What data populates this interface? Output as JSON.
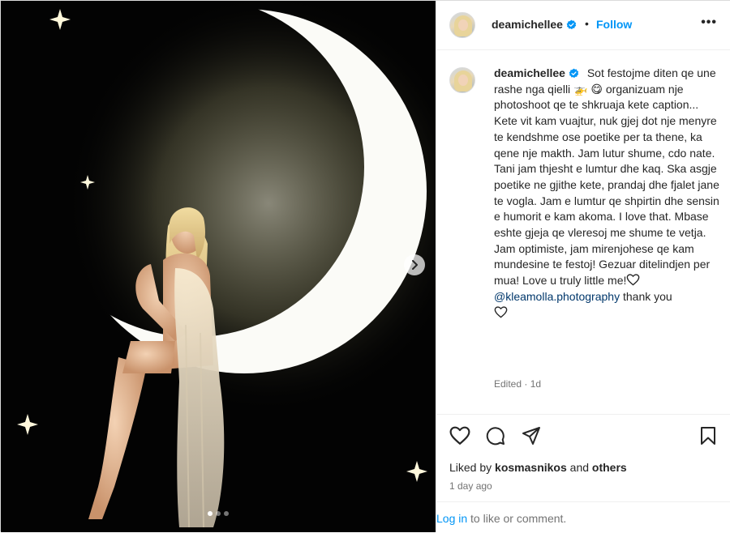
{
  "post": {
    "username": "deamichellee",
    "separator": "•",
    "follow_label": "Follow",
    "more_label": "•••",
    "caption": {
      "text_main": "Sot festojme diten qe une rashe nga qielli 🚁 😋 organizuam nje photoshoot qe te shkruaja kete caption... Kete vit kam vuajtur, nuk gjej dot nje menyre te kendshme ose poetike per ta thene, ka qene nje makth. Jam lutur shume, cdo nate. Tani jam thjesht e lumtur dhe kaq. Ska asgje poetike ne gjithe kete, prandaj dhe fjalet jane te vogla. Jam e lumtur qe shpirtin dhe sensin e humorit e kam akoma. I love that. Mbase eshte gjeja qe vleresoj me shume te vetja. Jam optimiste, jam mirenjohese qe kam mundesine te festoj! Gezuar ditelindjen per mua! Love u truly little me!",
      "mention": "@kleamolla.photography",
      "after_mention": "thank you"
    },
    "edited_label": "Edited · 1d",
    "liked_by_prefix": "Liked by",
    "liked_by_user": "kosmasnikos",
    "liked_and": "and",
    "liked_others": "others",
    "timestamp": "1 day ago",
    "login_link": "Log in",
    "login_suffix": "to like or comment."
  },
  "carousel": {
    "slide_count": 3,
    "active_index": 0
  },
  "icons": {
    "verified": "verified-badge-icon",
    "like": "heart-icon",
    "comment": "comment-icon",
    "share": "share-icon",
    "save": "bookmark-icon",
    "next": "chevron-right-icon"
  },
  "colors": {
    "link_blue": "#0095f6",
    "mention_blue": "#00376b",
    "muted": "#737373",
    "text": "#262626"
  }
}
